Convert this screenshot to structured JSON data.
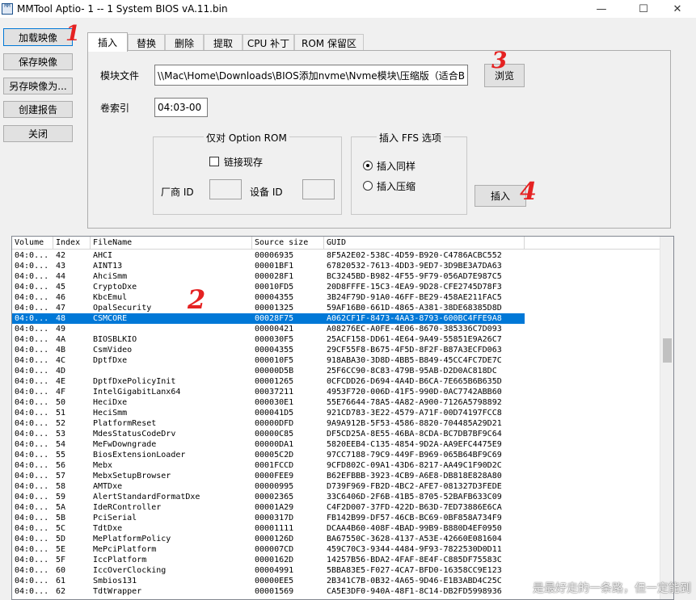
{
  "window": {
    "title": "MMTool Aptio- 1 -- 1 System BIOS vA.11.bin",
    "icon_text": "MM",
    "minimize_glyph": "—",
    "maximize_glyph": "☐",
    "close_glyph": "✕"
  },
  "left_buttons": {
    "load": "加载映像",
    "save": "保存映像",
    "save_as": "另存映像为...",
    "report": "创建报告",
    "close": "关闭"
  },
  "tabs": [
    "插入",
    "替换",
    "删除",
    "提取",
    "CPU 补丁",
    "ROM 保留区"
  ],
  "insert_panel": {
    "module_file_label": "模块文件",
    "module_file_value": "\\\\Mac\\Home\\Downloads\\BIOS添加nvme\\Nvme模块\\压缩版（适合B",
    "browse": "浏览",
    "volume_index_label": "卷索引",
    "volume_index_value": "04:03-00",
    "option_rom_group": "仅对 Option ROM",
    "link_checkbox": "链接现存",
    "vendor_id_label": "厂商 ID",
    "device_id_label": "设备 ID",
    "ffs_group": "插入 FFS 选项",
    "radio_same": "插入同样",
    "radio_compressed": "插入压缩",
    "insert_button": "插入"
  },
  "table": {
    "columns": [
      "Volume",
      "Index",
      "FileName",
      "Source size",
      "GUID"
    ],
    "selected_index": 6,
    "rows": [
      [
        "04:0...",
        "42",
        "AHCI",
        "00006935",
        "8F5A2E02-538C-4D59-B920-C4786ACBC552"
      ],
      [
        "04:0...",
        "43",
        "AINT13",
        "00001BF1",
        "67820532-7613-4DD3-9ED7-3D9BE3A7DA63"
      ],
      [
        "04:0...",
        "44",
        "AhciSmm",
        "000028F1",
        "BC3245BD-B982-4F55-9F79-056AD7E987C5"
      ],
      [
        "04:0...",
        "45",
        "CryptoDxe",
        "00010FD5",
        "20D8FFFE-15C3-4EA9-9D28-CFE2745D78F3"
      ],
      [
        "04:0...",
        "46",
        "KbcEmul",
        "00004355",
        "3B24F79D-91A0-46FF-BE29-458AE211FAC5"
      ],
      [
        "04:0...",
        "47",
        "OpalSecurity",
        "00001325",
        "59AF16B0-661D-4865-A381-38DE68385D8D"
      ],
      [
        "04:0...",
        "48",
        "CSMCORE",
        "00028F75",
        "A062CF1F-8473-4AA3-8793-600BC4FFE9A8"
      ],
      [
        "04:0...",
        "49",
        "",
        "00000421",
        "A08276EC-A0FE-4E06-8670-385336C7D093"
      ],
      [
        "04:0...",
        "4A",
        "BIOSBLKIO",
        "000030F5",
        "25ACF158-DD61-4E64-9A49-55851E9A26C7"
      ],
      [
        "04:0...",
        "4B",
        "CsmVideo",
        "00004355",
        "29CF55F8-B675-4F5D-8F2F-B87A3ECFD063"
      ],
      [
        "04:0...",
        "4C",
        "DptfDxe",
        "000010F5",
        "918ABA30-3D8D-4BB5-B849-45CC4FC7DE7C"
      ],
      [
        "04:0...",
        "4D",
        "",
        "00000D5B",
        "25F6CC90-8C83-479B-95AB-D2D0AC818DC"
      ],
      [
        "04:0...",
        "4E",
        "DptfDxePolicyInit",
        "00001265",
        "0CFCDD26-D694-4A4D-B6CA-7E665B6B635D"
      ],
      [
        "04:0...",
        "4F",
        "IntelGigabitLanx64",
        "00037211",
        "4953F720-006D-41F5-990D-0AC7742ABB60"
      ],
      [
        "04:0...",
        "50",
        "HeciDxe",
        "000030E1",
        "55E76644-78A5-4A82-A900-7126A5798892"
      ],
      [
        "04:0...",
        "51",
        "HeciSmm",
        "000041D5",
        "921CD783-3E22-4579-A71F-00D74197FCC8"
      ],
      [
        "04:0...",
        "52",
        "PlatformReset",
        "00000DFD",
        "9A9A912B-5F53-4586-8820-704485A29D21"
      ],
      [
        "04:0...",
        "53",
        "MdesStatusCodeDrv",
        "00000C85",
        "DF5CD25A-8E55-46BA-8CDA-BC7DB7BF9C64"
      ],
      [
        "04:0...",
        "54",
        "MeFwDowngrade",
        "00000DA1",
        "5820EEB4-C135-4854-9D2A-AA9EFC4475E9"
      ],
      [
        "04:0...",
        "55",
        "BiosExtensionLoader",
        "00005C2D",
        "97CC7188-79C9-449F-B969-065B64BF9C69"
      ],
      [
        "04:0...",
        "56",
        "Mebx",
        "0001FCCD",
        "9CFD802C-09A1-43D6-8217-AA49C1F90D2C"
      ],
      [
        "04:0...",
        "57",
        "MebxSetupBrowser",
        "0000FEE9",
        "B62EFBBB-3923-4CB9-A6E8-DB818E828A80"
      ],
      [
        "04:0...",
        "58",
        "AMTDxe",
        "00000995",
        "D739F969-FB2D-4BC2-AFE7-081327D3FEDE"
      ],
      [
        "04:0...",
        "59",
        "AlertStandardFormatDxe",
        "00002365",
        "33C6406D-2F6B-41B5-8705-52BAFB633C09"
      ],
      [
        "04:0...",
        "5A",
        "IdeRController",
        "00001A29",
        "C4F2D007-37FD-422D-B63D-7ED73886E6CA"
      ],
      [
        "04:0...",
        "5B",
        "PciSerial",
        "0000317D",
        "FB142B99-DF57-46CB-BC69-0BF858A734F9"
      ],
      [
        "04:0...",
        "5C",
        "TdtDxe",
        "00001111",
        "DCAA4B60-408F-4BAD-99B9-B880D4EF0950"
      ],
      [
        "04:0...",
        "5D",
        "MePlatformPolicy",
        "0000126D",
        "BA67550C-3628-4137-A53E-42660E081604"
      ],
      [
        "04:0...",
        "5E",
        "MePciPlatform",
        "000007CD",
        "459C70C3-9344-4484-9F93-7822530D0D11"
      ],
      [
        "04:0...",
        "5F",
        "IccPlatform",
        "0000162D",
        "14257B56-BDA2-4FAF-8E4F-C885DF75583C"
      ],
      [
        "04:0...",
        "60",
        "IccOverClocking",
        "00004991",
        "5BBA83E5-F027-4CA7-BFD0-16358CC9E123"
      ],
      [
        "04:0...",
        "61",
        "Smbios131",
        "00000EE5",
        "2B341C7B-0B32-4A65-9D46-E1B3ABD4C25C"
      ],
      [
        "04:0...",
        "62",
        "TdtWrapper",
        "00001569",
        "CA5E3DF0-940A-48F1-8C14-DB2FD5998936"
      ]
    ]
  },
  "annotations": {
    "n1": "1",
    "n2": "2",
    "n3": "3",
    "n4": "4"
  },
  "watermark": "是最好走的一条路，但一定能到",
  "colors": {
    "selection": "#0078d7",
    "annotation_red": "#e52222"
  }
}
